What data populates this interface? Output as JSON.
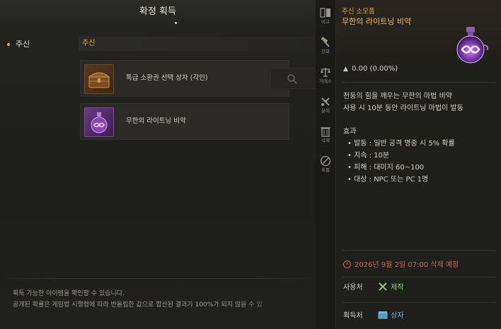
{
  "window": {
    "title": "확정 획득"
  },
  "category_list": {
    "items": [
      {
        "label": "주신"
      }
    ]
  },
  "section": {
    "header": "주신"
  },
  "items": [
    {
      "name": "특급 소환권 선택 상자 (각인)",
      "icon": "treasure-chest-icon"
    },
    {
      "name": "무한의 라이트닝 비약",
      "icon": "purple-potion-icon"
    }
  ],
  "footer": {
    "line1": "획득 가능한 아이템을 확인할 수 있습니다.",
    "line2": "공개된 확률은 게임법 시행령에 따라 반올림한 값으로 합산된 결과가 100%가 되지 않을 수 있"
  },
  "toolbar": {
    "buttons": [
      {
        "label": "비교",
        "icon": "compare-icon"
      },
      {
        "label": "강화",
        "icon": "enhance-hammer-icon"
      },
      {
        "label": "거래소",
        "icon": "scale-icon"
      },
      {
        "label": "분해",
        "icon": "dismantle-icon"
      },
      {
        "label": "삭제",
        "icon": "trash-icon"
      },
      {
        "label": "획률",
        "icon": "probability-icon"
      }
    ]
  },
  "tooltip": {
    "category": "주신 소모품",
    "name": "무한의 라이트닝 비약",
    "icon": "infinity-potion-icon",
    "price": "0.00 (0.00%)",
    "description": [
      "천둥의 힘을 깨우는 무한의 마법 비약",
      "사용 시 10분 동안 라이트닝 마법이 발동"
    ],
    "effects_title": "효과",
    "effects": [
      "• 발동 : 일반 공격 명중 시 5% 확률",
      "• 지속 : 10분",
      "• 피해 : 대미지 60~100",
      "• 대상 : NPC 또는 PC 1명"
    ],
    "expire": "2026년 9월 2일 07:00 삭제 예정",
    "usage_label": "사용처",
    "usage_link": "제작",
    "source_label": "획득처",
    "source_link": "상자"
  },
  "colors": {
    "accent": "#e3a84a",
    "expire": "#d06a4a",
    "link_blue": "#7ec0d8",
    "link_green": "#9ccf86"
  }
}
